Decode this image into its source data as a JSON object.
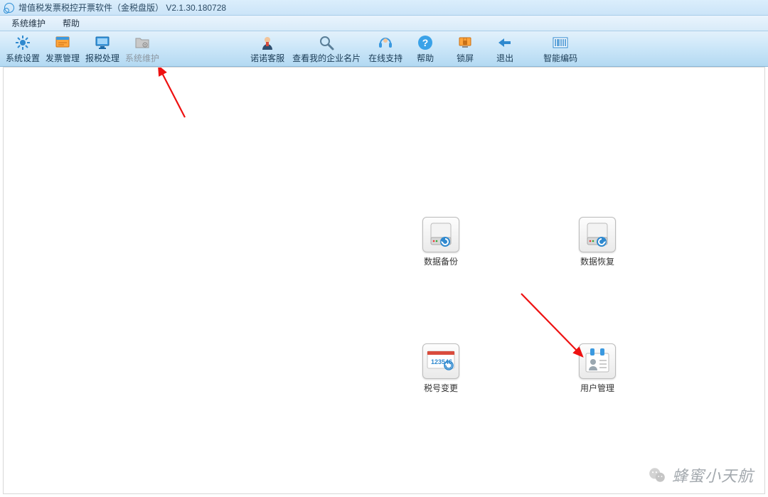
{
  "window": {
    "title": "增值税发票税控开票软件（金税盘版） V2.1.30.180728"
  },
  "menu": {
    "items": [
      "系统维护",
      "帮助"
    ]
  },
  "toolbar": {
    "system_settings": "系统设置",
    "invoice_management": "发票管理",
    "tax_processing": "报税处理",
    "system_maintenance": "系统维护",
    "nuonuo_service": "诺诺客服",
    "view_my_business_card": "查看我的企业名片",
    "online_support": "在线支持",
    "help": "帮助",
    "lock_screen": "锁屏",
    "exit": "退出",
    "smart_coding": "智能编码"
  },
  "desktop": {
    "data_backup": "数据备份",
    "data_restore": "数据恢复",
    "tax_number_change": "税号变更",
    "user_management": "用户管理"
  },
  "watermark": {
    "text": "蜂蜜小天航"
  }
}
